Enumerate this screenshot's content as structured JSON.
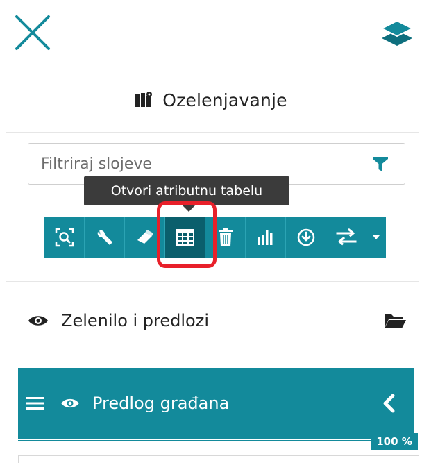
{
  "header": {
    "close_icon": "close-icon",
    "layers_icon": "layers-icon",
    "title": "Ozelenjavanje",
    "title_icon": "map-icon"
  },
  "filter": {
    "placeholder": "Filtriraj slojeve",
    "icon": "filter-icon"
  },
  "tooltip": {
    "text": "Otvori atributnu tabelu"
  },
  "toolbar": {
    "buttons": [
      {
        "icon": "zoom-to-extent-icon"
      },
      {
        "icon": "wrench-icon"
      },
      {
        "icon": "eraser-icon"
      },
      {
        "icon": "table-icon",
        "active": true
      },
      {
        "icon": "trash-icon"
      },
      {
        "icon": "bar-chart-icon"
      },
      {
        "icon": "download-icon"
      },
      {
        "icon": "swap-icon"
      },
      {
        "icon": "caret-down-icon"
      }
    ]
  },
  "group": {
    "label": "Zelenilo i predlozi",
    "eye_icon": "eye-icon",
    "folder_icon": "folder-open-icon"
  },
  "layer": {
    "label": "Predlog građana",
    "menu_icon": "hamburger-icon",
    "eye_icon": "eye-icon",
    "collapse_icon": "chevron-left-icon",
    "opacity_percent": 100,
    "opacity_label": "100 %"
  },
  "colors": {
    "accent": "#138a9b",
    "accent_dark": "#0a5f6c",
    "tooltip_bg": "#3b3b3b",
    "highlight": "#e8202a"
  }
}
